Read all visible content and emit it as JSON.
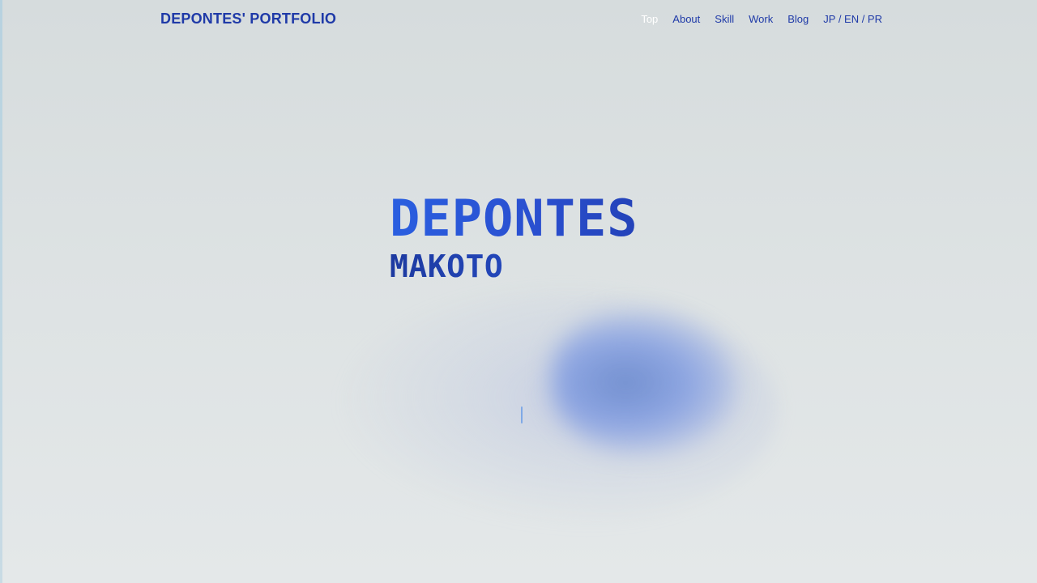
{
  "header": {
    "brand": "DEPONTES' PORTFOLIO",
    "nav": [
      {
        "label": "Top",
        "active": true
      },
      {
        "label": "About",
        "active": false
      },
      {
        "label": "Skill",
        "active": false
      },
      {
        "label": "Work",
        "active": false
      },
      {
        "label": "Blog",
        "active": false
      },
      {
        "label": "JP / EN / PR",
        "active": false
      }
    ]
  },
  "hero": {
    "first_line": "DEPONTES",
    "second_line": "MAKOTO"
  },
  "colors": {
    "accent": "#1f3aa8",
    "active_nav": "#ffffff",
    "title_gradient_start": "#2a5fe0",
    "title_gradient_end": "#2342b8",
    "background": "#dde2e3"
  }
}
